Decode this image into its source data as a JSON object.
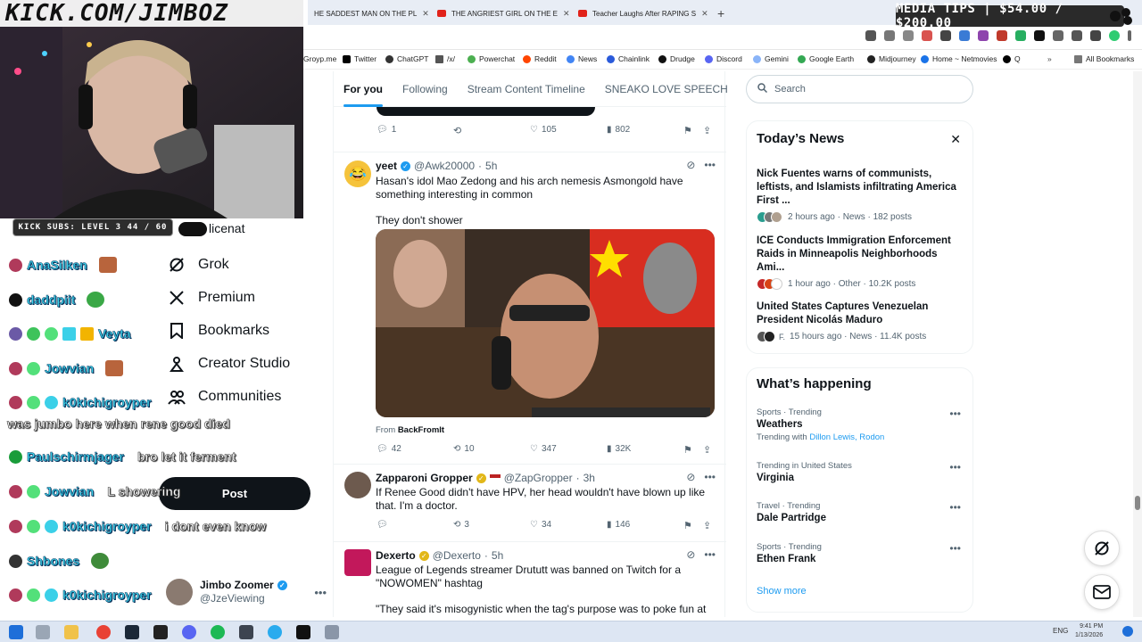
{
  "overlay": {
    "banner": "KICK.COM/JIMBOZ",
    "media_tips": "MEDIA TIPS | $54.00 / $200.00",
    "kick_subs": "KICK SUBS: LEVEL 3 44 / 60"
  },
  "browser": {
    "tabs": [
      {
        "label": "HE SADDEST MAN ON THE PL"
      },
      {
        "label": "THE ANGRIEST GIRL ON THE E"
      },
      {
        "label": "Teacher Laughs After RAPING S"
      }
    ],
    "bookmarks": [
      "Groyp.me",
      "Twitter",
      "ChatGPT",
      "/x/",
      "Powerchat",
      "Reddit",
      "News",
      "Chainlink",
      "Drudge",
      "Discord",
      "Gemini",
      "Google Earth",
      "Midjourney",
      "Home ~ Netmovies",
      "Q",
      "All Bookmarks"
    ]
  },
  "chat": [
    {
      "user": "AnaSilken",
      "message": "",
      "color": "#3bd0e8"
    },
    {
      "user": "daddpiit",
      "message": "",
      "color": "#3bd0e8"
    },
    {
      "user": "Veyta",
      "message": "",
      "color": "#3bd0e8"
    },
    {
      "user": "Jowvian",
      "message": "",
      "color": "#3bd0e8"
    },
    {
      "user": "k0kichigroyper",
      "message": "",
      "color": "#3bd0e8"
    },
    {
      "user": "",
      "message": "was jumbo here when rene good died",
      "color": "#fff"
    },
    {
      "user": "Paulschirmjager",
      "message": "bro let it ferment",
      "color": "#3bd0e8"
    },
    {
      "user": "Jowvian",
      "message": "L showering",
      "color": "#3bd0e8"
    },
    {
      "user": "k0kichigroyper",
      "message": "i dont even know",
      "color": "#3bd0e8"
    },
    {
      "user": "Shbones",
      "message": "",
      "color": "#3bd0e8"
    },
    {
      "user": "k0kichigroyper",
      "message": "",
      "color": "#3bd0e8"
    }
  ],
  "nav": {
    "partial_label": "licenat",
    "items": [
      {
        "label": "Grok",
        "icon": "grok-icon"
      },
      {
        "label": "Premium",
        "icon": "x-icon"
      },
      {
        "label": "Bookmarks",
        "icon": "bookmark-icon"
      },
      {
        "label": "Creator Studio",
        "icon": "creator-icon"
      },
      {
        "label": "Communities",
        "icon": "communities-icon"
      }
    ],
    "post_button": "Post",
    "account": {
      "name": "Jimbo Zoomer",
      "handle": "@JzeViewing"
    }
  },
  "feed": {
    "tabs": [
      "For you",
      "Following",
      "Stream Content Timeline",
      "SNEAKO LOVE SPEECH"
    ],
    "top_actions": {
      "replies": "1",
      "likes": "105",
      "views": "802"
    },
    "posts": [
      {
        "name": "yeet",
        "handle": "@Awk20000",
        "time": "5h",
        "text1": "Hasan's idol Mao Zedong and his arch nemesis Asmongold have something interesting in common",
        "text2": "They don't shower",
        "from_prefix": "From",
        "from": "BackFromIt",
        "replies": "42",
        "reposts": "10",
        "likes": "347",
        "views": "32K"
      },
      {
        "name": "Zapparoni Gropper",
        "handle": "@ZapGropper",
        "time": "3h",
        "text1": "If Renee Good didn't have HPV, her head wouldn't have blown up like that. I'm a doctor.",
        "replies": "",
        "reposts": "3",
        "likes": "34",
        "views": "146"
      },
      {
        "name": "Dexerto",
        "handle": "@Dexerto",
        "time": "5h",
        "text1": "League of Legends streamer Drututt was banned on Twitch for a \"NOWOMEN\" hashtag",
        "text2": "\"They said it's misogynistic when the tag's purpose was to poke fun at"
      }
    ]
  },
  "sidebar": {
    "search_placeholder": "Search",
    "news_title": "Today’s News",
    "news": [
      {
        "title": "Nick Fuentes warns of communists, leftists, and Islamists infiltrating America First ...",
        "meta": "2 hours ago · News · 182 posts"
      },
      {
        "title": "ICE Conducts Immigration Enforcement Raids in Minneapolis Neighborhoods Ami...",
        "meta": "1 hour ago · Other · 10.2K posts"
      },
      {
        "title": "United States Captures Venezuelan President Nicolás Maduro",
        "meta": "15 hours ago · News · 11.4K posts",
        "avatar_text": "F."
      }
    ],
    "happening_title": "What’s happening",
    "trends": [
      {
        "meta": "Sports · Trending",
        "name": "Weathers",
        "with_prefix": "Trending with",
        "with": "Dillon Lewis, Rodon"
      },
      {
        "meta": "Trending in United States",
        "name": "Virginia"
      },
      {
        "meta": "Travel · Trending",
        "name": "Dale Partridge"
      },
      {
        "meta": "Sports · Trending",
        "name": "Ethen Frank"
      }
    ],
    "show_more": "Show more"
  },
  "taskbar": {
    "lang": "ENG",
    "time": "9:41 PM",
    "date": "1/13/2026"
  },
  "colors": {
    "accent": "#1d9bf0",
    "text": "#0f1419",
    "muted": "#536471",
    "chat_name": "#3bd0e8"
  }
}
